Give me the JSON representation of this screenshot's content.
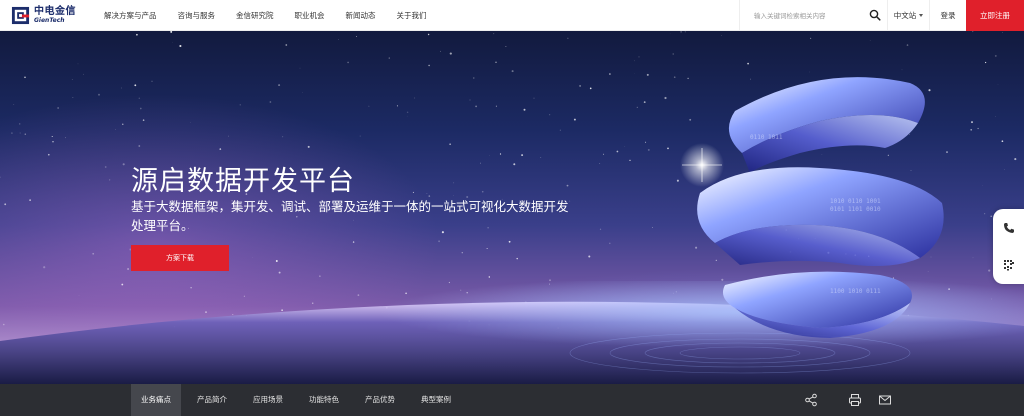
{
  "header": {
    "logo_cn": "中电金信",
    "logo_en": "GienTech",
    "nav": [
      {
        "label": "解决方案与产品"
      },
      {
        "label": "咨询与服务"
      },
      {
        "label": "金信研究院"
      },
      {
        "label": "职业机会"
      },
      {
        "label": "新闻动态"
      },
      {
        "label": "关于我们"
      }
    ],
    "search_placeholder": "输入关键词检索相关内容",
    "language": "中文站",
    "login": "登录",
    "register": "立即注册"
  },
  "hero": {
    "title": "源启数据开发平台",
    "description": "基于大数据框架，集开发、调试、部署及运维于一体的一站式可视化大数据开发处理平台。",
    "button": "方案下载"
  },
  "side_float": {
    "icons": [
      "phone-icon",
      "qrcode-icon"
    ]
  },
  "tabbar": {
    "tabs": [
      {
        "label": "业务痛点",
        "active": true
      },
      {
        "label": "产品简介",
        "active": false
      },
      {
        "label": "应用场景",
        "active": false
      },
      {
        "label": "功能特色",
        "active": false
      },
      {
        "label": "产品优势",
        "active": false
      },
      {
        "label": "典型案例",
        "active": false
      }
    ],
    "tools": [
      "share-icon",
      "print-icon",
      "mail-icon"
    ]
  },
  "colors": {
    "accent_red": "#e0202b",
    "brand_blue": "#1c2d6b",
    "tabbar_bg": "#2c2e33"
  }
}
